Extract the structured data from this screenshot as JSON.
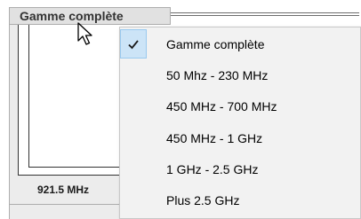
{
  "combo": {
    "selected_label": "Gamme complète"
  },
  "readout": {
    "frequency": "921.5 MHz"
  },
  "menu": {
    "items": [
      {
        "label": "Gamme complète",
        "checked": true
      },
      {
        "label": "50 Mhz - 230 MHz",
        "checked": false
      },
      {
        "label": "450 MHz - 700 MHz",
        "checked": false
      },
      {
        "label": "450 MHz - 1 GHz",
        "checked": false
      },
      {
        "label": "1 GHz - 2.5 GHz",
        "checked": false
      },
      {
        "label": "Plus 2.5 GHz",
        "checked": false
      }
    ]
  },
  "icons": {
    "check": "check-icon",
    "cursor": "mouse-cursor-icon"
  },
  "colors": {
    "checked_highlight": "#cce4f7",
    "checked_border": "#99c9ef",
    "menu_background": "#f2f2f2"
  }
}
